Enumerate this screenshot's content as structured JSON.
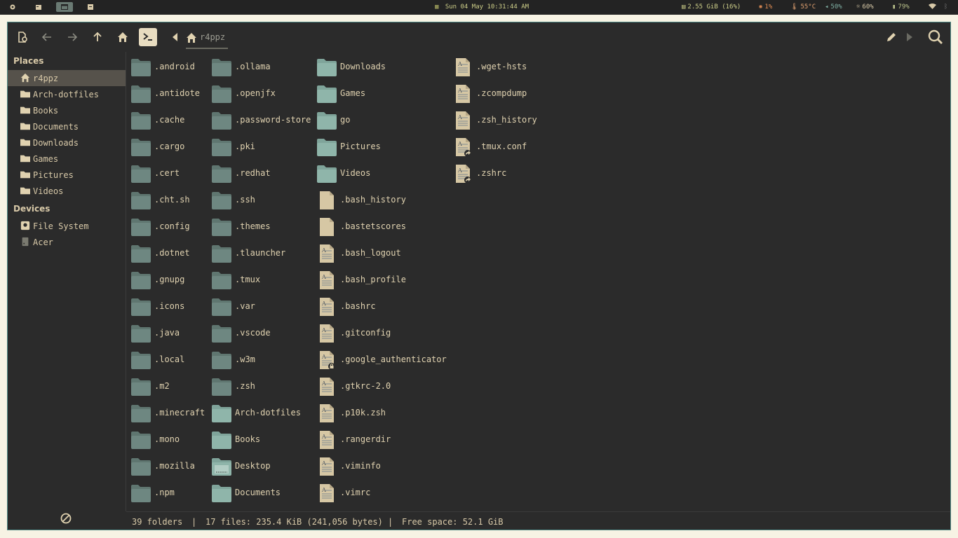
{
  "topbar": {
    "clock": "Sun 04 May 10:31:44 AM",
    "memory": "2.55 GiB (16%)",
    "cpu": "1%",
    "temperature": "55°C",
    "volume": "50%",
    "brightness": "60%",
    "battery": "79%",
    "accent": "#cfd08a"
  },
  "breadcrumb": {
    "label": "r4ppz"
  },
  "sidebar": {
    "places_title": "Places",
    "places": [
      "r4ppz",
      "Arch-dotfiles",
      "Books",
      "Documents",
      "Downloads",
      "Games",
      "Pictures",
      "Videos"
    ],
    "devices_title": "Devices",
    "devices": [
      "File System",
      "Acer"
    ]
  },
  "files": {
    "col1": [
      ".android",
      ".antidote",
      ".cache",
      ".cargo",
      ".cert",
      ".cht.sh",
      ".config",
      ".dotnet",
      ".gnupg",
      ".icons",
      ".java",
      ".local",
      ".m2",
      ".minecraft",
      ".mono",
      ".mozilla",
      ".npm"
    ],
    "col2": [
      ".ollama",
      ".openjfx",
      ".password-store",
      ".pki",
      ".redhat",
      ".ssh",
      ".themes",
      ".tlauncher",
      ".tmux",
      ".var",
      ".vscode",
      ".w3m",
      ".zsh",
      "Arch-dotfiles",
      "Books",
      "Desktop",
      "Documents"
    ],
    "col3": [
      "Downloads",
      "Games",
      "go",
      "Pictures",
      "Videos",
      ".bash_history",
      ".bastetscores",
      ".bash_logout",
      ".bash_profile",
      ".bashrc",
      ".gitconfig",
      ".google_authenticator",
      ".gtkrc-2.0",
      ".p10k.zsh",
      ".rangerdir",
      ".viminfo",
      ".vimrc"
    ],
    "col4": [
      ".wget-hsts",
      ".zcompdump",
      ".zsh_history",
      ".tmux.conf",
      ".zshrc"
    ]
  },
  "status": {
    "folders": "39 folders",
    "sep1": "|",
    "files": "17 files: 235.4 KiB (241,056 bytes)",
    "sep2": "|",
    "free": "Free space: 52.1 GiB"
  }
}
